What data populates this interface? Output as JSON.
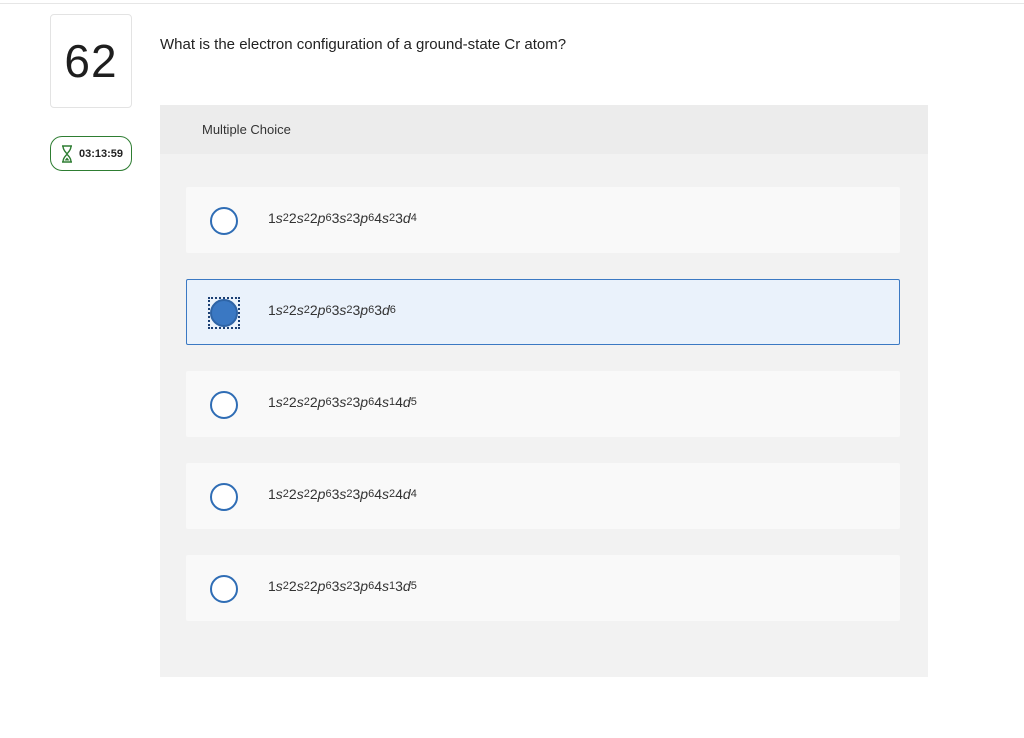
{
  "question": {
    "number": "62",
    "timer": "03:13:59",
    "text": "What is the electron configuration of a ground-state Cr atom?",
    "type_label": "Multiple Choice"
  },
  "options": [
    {
      "selected": false,
      "terms": [
        {
          "n": "1",
          "l": "s",
          "e": "2"
        },
        {
          "n": "2",
          "l": "s",
          "e": "2"
        },
        {
          "n": "2",
          "l": "p",
          "e": "6"
        },
        {
          "n": "3",
          "l": "s",
          "e": "2"
        },
        {
          "n": "3",
          "l": "p",
          "e": "6"
        },
        {
          "n": "4",
          "l": "s",
          "e": "2"
        },
        {
          "n": "3",
          "l": "d",
          "e": "4"
        }
      ]
    },
    {
      "selected": true,
      "terms": [
        {
          "n": "1",
          "l": "s",
          "e": "2"
        },
        {
          "n": "2",
          "l": "s",
          "e": "2"
        },
        {
          "n": "2",
          "l": "p",
          "e": "6"
        },
        {
          "n": "3",
          "l": "s",
          "e": "2"
        },
        {
          "n": "3",
          "l": "p",
          "e": "6"
        },
        {
          "n": "3",
          "l": "d",
          "e": "6"
        }
      ]
    },
    {
      "selected": false,
      "terms": [
        {
          "n": "1",
          "l": "s",
          "e": "2"
        },
        {
          "n": "2",
          "l": "s",
          "e": "2"
        },
        {
          "n": "2",
          "l": "p",
          "e": "6"
        },
        {
          "n": "3",
          "l": "s",
          "e": "2"
        },
        {
          "n": "3",
          "l": "p",
          "e": "6"
        },
        {
          "n": "4",
          "l": "s",
          "e": "1"
        },
        {
          "n": "4",
          "l": "d",
          "e": "5"
        }
      ]
    },
    {
      "selected": false,
      "terms": [
        {
          "n": "1",
          "l": "s",
          "e": "2"
        },
        {
          "n": "2",
          "l": "s",
          "e": "2"
        },
        {
          "n": "2",
          "l": "p",
          "e": "6"
        },
        {
          "n": "3",
          "l": "s",
          "e": "2"
        },
        {
          "n": "3",
          "l": "p",
          "e": "6"
        },
        {
          "n": "4",
          "l": "s",
          "e": "2"
        },
        {
          "n": "4",
          "l": "d",
          "e": "4"
        }
      ]
    },
    {
      "selected": false,
      "terms": [
        {
          "n": "1",
          "l": "s",
          "e": "2"
        },
        {
          "n": "2",
          "l": "s",
          "e": "2"
        },
        {
          "n": "2",
          "l": "p",
          "e": "6"
        },
        {
          "n": "3",
          "l": "s",
          "e": "2"
        },
        {
          "n": "3",
          "l": "p",
          "e": "6"
        },
        {
          "n": "4",
          "l": "s",
          "e": "1"
        },
        {
          "n": "3",
          "l": "d",
          "e": "5"
        }
      ]
    }
  ],
  "colors": {
    "accent": "#3a78c3",
    "timer_border": "#2e7d32",
    "selected_bg": "#eaf2fb"
  },
  "icons": {
    "timer": "hourglass-icon"
  }
}
